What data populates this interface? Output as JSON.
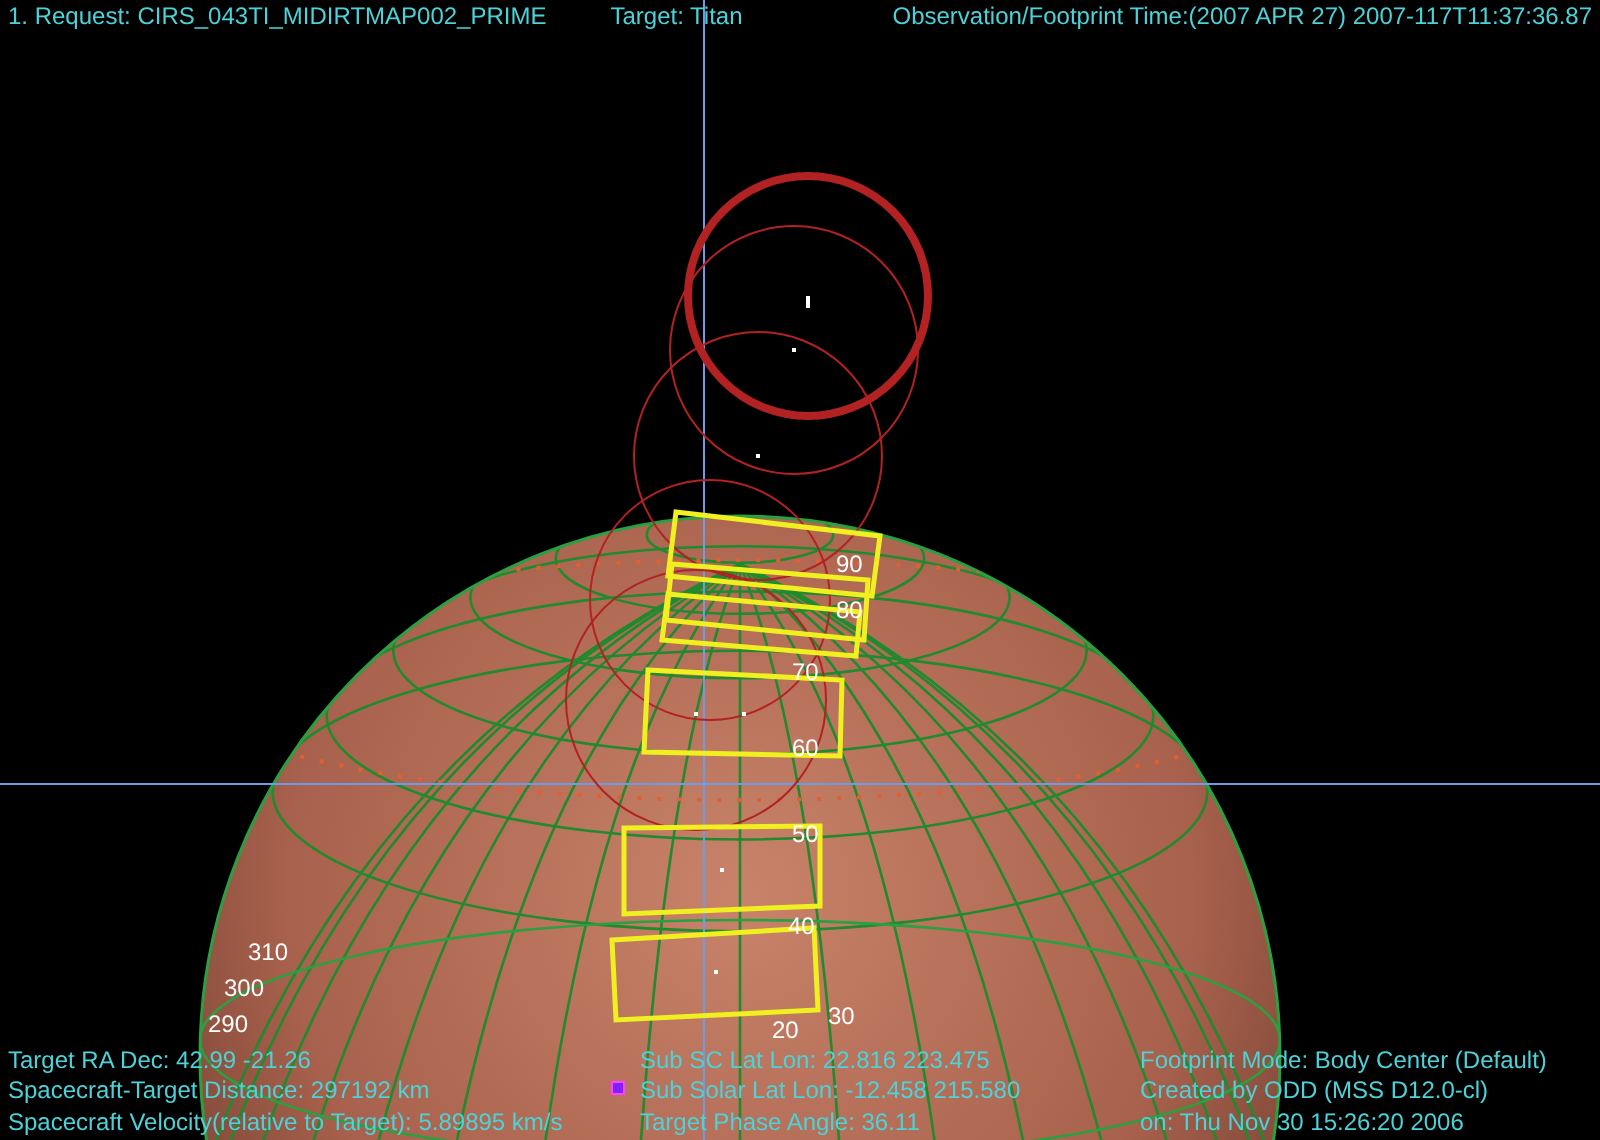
{
  "header": {
    "request": "1. Request:  CIRS_043TI_MIDIRTMAP002_PRIME",
    "target": "Target: Titan",
    "time": "Observation/Footprint Time:(2007 APR 27) 2007-117T11:37:36.87"
  },
  "grid_labels": [
    {
      "text": "90"
    },
    {
      "text": "80"
    },
    {
      "text": "70"
    },
    {
      "text": "60"
    },
    {
      "text": "50"
    },
    {
      "text": "40"
    },
    {
      "text": "30"
    },
    {
      "text": "20"
    },
    {
      "text": "310"
    },
    {
      "text": "300"
    },
    {
      "text": "290"
    }
  ],
  "info_columns": [
    {
      "lines": [
        "Target RA Dec:  42.99  -21.26",
        "Spacecraft-Target Distance:  297192 km",
        "Spacecraft Velocity(relative to Target): 5.89895 km/s"
      ]
    },
    {
      "lines": [
        "Sub SC Lat Lon: 22.816  223.475",
        "Sub Solar Lat Lon: -12.458  215.580",
        "Target Phase Angle: 36.11"
      ]
    },
    {
      "lines": [
        "Footprint Mode: Body Center (Default)",
        "Created by ODD (MSS D12.0-cl)",
        "on: Thu Nov 30 15:26:20 2006"
      ]
    }
  ]
}
